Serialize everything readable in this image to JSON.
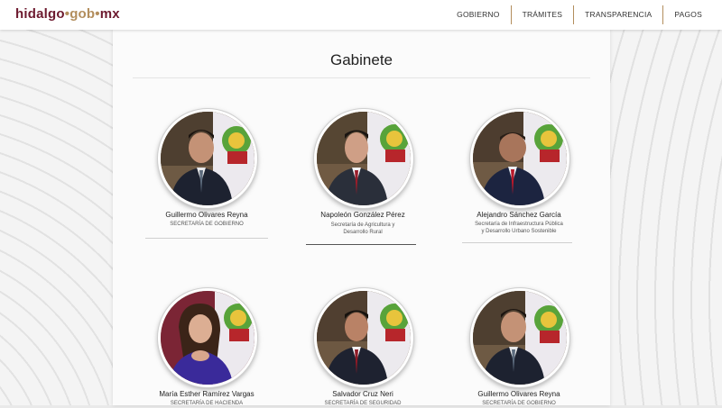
{
  "header": {
    "logo": {
      "part1": "hidalgo",
      "part2": "gob",
      "part3": "mx",
      "separator": "•"
    },
    "nav": [
      "GOBIERNO",
      "TRÁMITES",
      "TRANSPARENCIA",
      "PAGOS"
    ]
  },
  "page": {
    "title": "Gabinete"
  },
  "cabinet": [
    {
      "name": "Guillermo Olivares Reyna",
      "role": "SECRETARÍA DE GOBIERNO",
      "role2": ""
    },
    {
      "name": "Napoleón González Pérez",
      "role": "Secretaría de Agricultura y",
      "role2": "Desarrollo Rural"
    },
    {
      "name": "Alejandro Sánchez García",
      "role": "Secretaría de Infraestructura Pública",
      "role2": "y Desarrollo Urbano Sostenible"
    },
    {
      "name": "María Esther Ramírez Vargas",
      "role": "SECRETARÍA DE HACIENDA",
      "role2": ""
    },
    {
      "name": "Salvador Cruz Neri",
      "role": "SECRETARÍA DE SEGURIDAD",
      "role2": ""
    },
    {
      "name": "Guillermo Olivares Reyna",
      "role": "SECRETARÍA DE GOBIERNO",
      "role2": ""
    }
  ],
  "colors": {
    "brand_maroon": "#6d1a2f",
    "brand_gold": "#b38e5d"
  }
}
